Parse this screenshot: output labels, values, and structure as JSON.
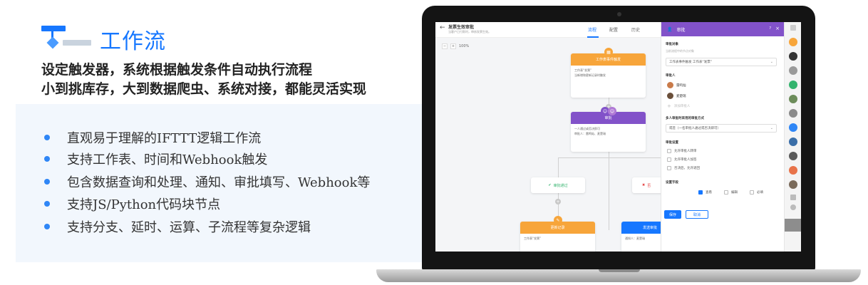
{
  "header": {
    "title": "工作流",
    "subtitle_line1": "设定触发器，系统根据触发条件自动执行流程",
    "subtitle_line2": "小到挑库存，大到数据爬虫、系统对接，都能灵活实现"
  },
  "features": [
    "直观易于理解的IFTTT逻辑工作流",
    "支持工作表、时间和Webhook触发",
    "包含数据查询和处理、通知、审批填写、Webhook等",
    "支持JS/Python代码块节点",
    "支持分支、延时、运算、子流程等复杂逻辑"
  ],
  "app": {
    "page_title": "发票生效审批",
    "page_subtitle": "当客户已付款时，审核发票生效。",
    "tabs": [
      "流程",
      "配置",
      "历史"
    ],
    "active_tab": "流程",
    "zoom": "100%",
    "nodes": {
      "trigger": {
        "title": "工作表事件触发",
        "line1": "工作表“发票”",
        "line2": "当新增和更新记录时触发"
      },
      "approval": {
        "title": "审批",
        "line1": "一人通过或否决即可",
        "line2": "审批人：雷鸣灿、麦楚瑞"
      },
      "branch_pass": "审批通过",
      "branch_reject": "否",
      "update": {
        "title": "更新记录",
        "line1": "工作表“发票”"
      },
      "send": {
        "title": "发送审批",
        "line1": "通知人：麦楚瑞"
      }
    },
    "panel": {
      "title": "审批",
      "target_label": "审批对象",
      "target_hint": "当前流程中的节点对象",
      "target_value": "工作表事件触发  工作表“发票”",
      "approvers_label": "审批人",
      "approvers": [
        "雷鸣灿",
        "麦楚瑞"
      ],
      "add_approver": "添加审批人",
      "multi_label": "多人审批时采用的审批方式",
      "multi_value": "或签（一名审批人通过或否决即可）",
      "settings_label": "审批设置",
      "settings": [
        "允许审批人转审",
        "允许审批人加签",
        "否决后，允许退回"
      ],
      "fields_label": "设置字段",
      "fields": [
        {
          "label": "查看",
          "checked": true
        },
        {
          "label": "编辑",
          "checked": false
        },
        {
          "label": "必填",
          "checked": false
        }
      ],
      "save": "保存",
      "cancel": "取消"
    }
  },
  "colors": {
    "accent": "#1677ff",
    "orange": "#f7a53a",
    "purple": "#8252c9",
    "green": "#34b46e"
  }
}
